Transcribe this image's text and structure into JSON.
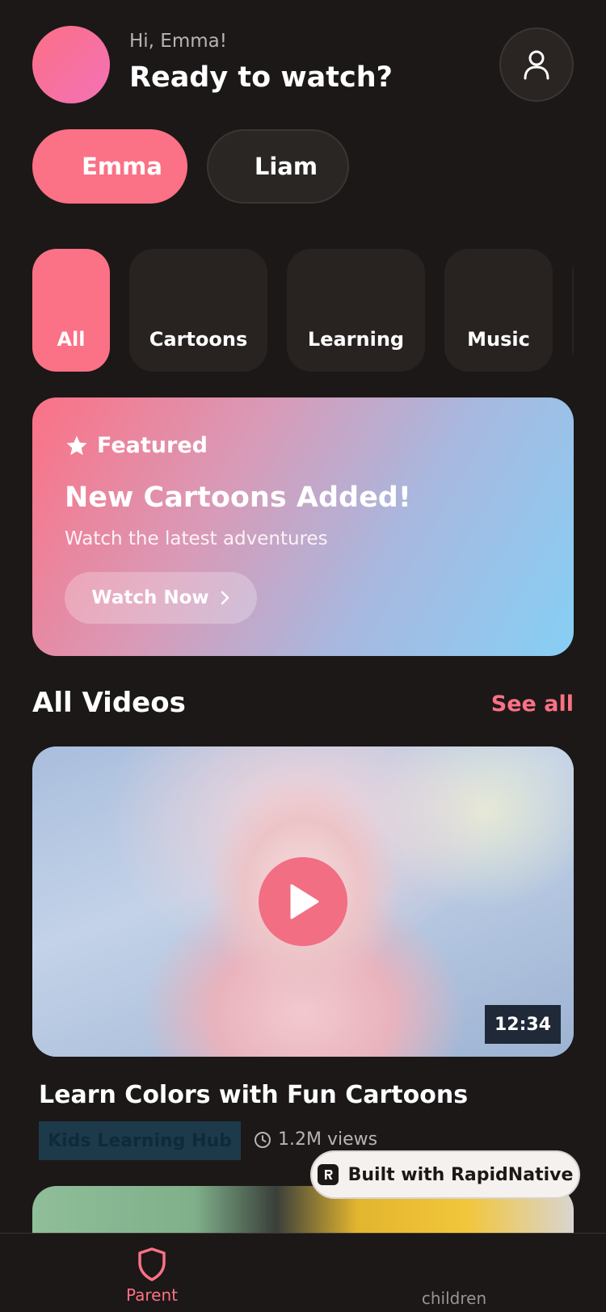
{
  "header": {
    "greeting": "Hi, Emma!",
    "title": "Ready to watch?",
    "profile_icon": "user-icon"
  },
  "kids": [
    {
      "name": "Emma",
      "active": true
    },
    {
      "name": "Liam",
      "active": false
    }
  ],
  "categories": [
    {
      "label": "All",
      "active": true
    },
    {
      "label": "Cartoons",
      "active": false
    },
    {
      "label": "Learning",
      "active": false
    },
    {
      "label": "Music",
      "active": false
    }
  ],
  "featured": {
    "tag": "Featured",
    "title": "New Cartoons Added!",
    "subtitle": "Watch the latest adventures",
    "button_label": "Watch Now"
  },
  "videos_section": {
    "title": "All Videos",
    "see_all": "See all"
  },
  "video": {
    "title": "Learn Colors with Fun Cartoons",
    "channel": "Kids Learning Hub",
    "views": "1.2M views",
    "duration": "12:34"
  },
  "badge": {
    "label": "Built with RapidNative"
  },
  "tabbar": {
    "parent_label": "Parent",
    "children_label": "children"
  },
  "colors": {
    "accent": "#fb7185",
    "background": "#1c1817",
    "card": "#282321"
  }
}
